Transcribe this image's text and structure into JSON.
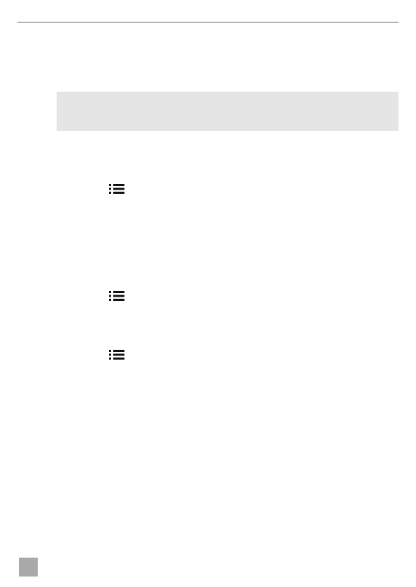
{
  "page": {
    "header_rule_color": "#b4b4b4",
    "note_box_color": "#e5e5e5",
    "page_tab_color": "#a9a9a9"
  },
  "icons": [
    {
      "name": "list-icon"
    },
    {
      "name": "list-icon"
    },
    {
      "name": "list-icon"
    }
  ]
}
